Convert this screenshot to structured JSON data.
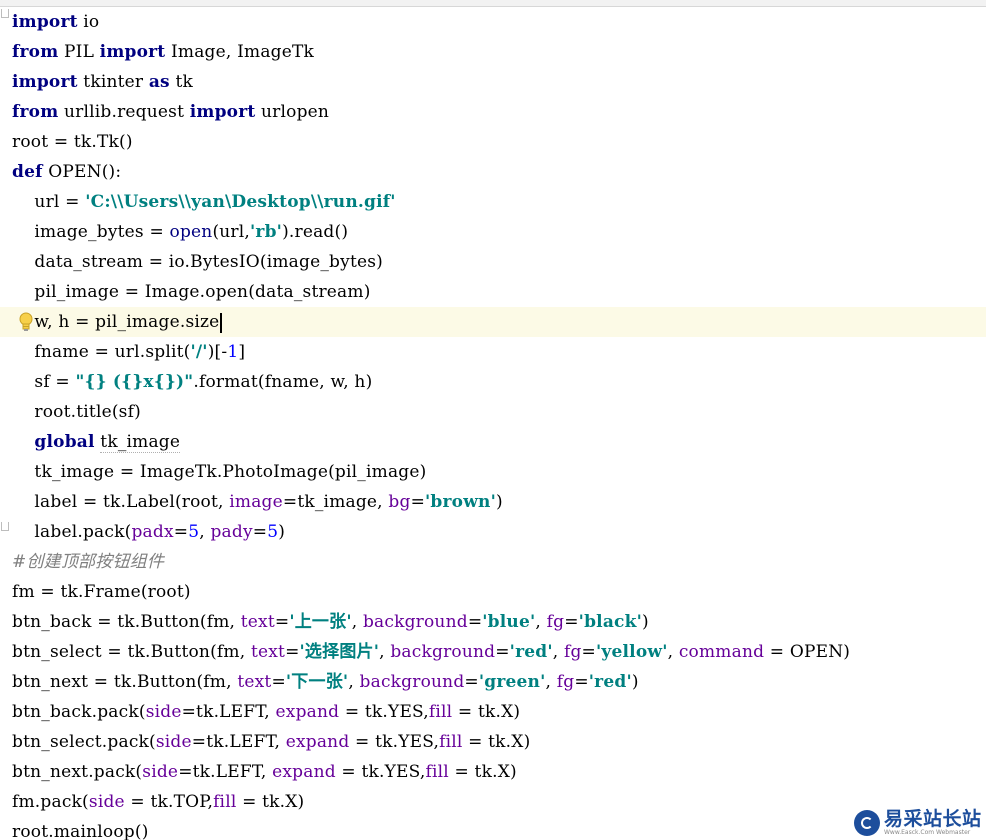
{
  "editor": {
    "lines": [
      [
        [
          "kw",
          "import"
        ],
        [
          "p",
          " io"
        ]
      ],
      [
        [
          "kw",
          "from"
        ],
        [
          "p",
          " PIL "
        ],
        [
          "kw",
          "import"
        ],
        [
          "p",
          " Image, ImageTk"
        ]
      ],
      [
        [
          "kw",
          "import"
        ],
        [
          "p",
          " tkinter "
        ],
        [
          "kw",
          "as"
        ],
        [
          "p",
          " tk"
        ]
      ],
      [
        [
          "kw",
          "from"
        ],
        [
          "p",
          " urllib.request "
        ],
        [
          "kw",
          "import"
        ],
        [
          "p",
          " urlopen"
        ]
      ],
      [
        [
          "p",
          "root = tk.Tk()"
        ]
      ],
      [
        [
          "kw",
          "def"
        ],
        [
          "p",
          " OPEN():"
        ]
      ],
      [
        [
          "p",
          "    url = "
        ],
        [
          "str",
          "'C:\\\\Users\\\\yan\\Desktop\\\\run.gif'"
        ]
      ],
      [
        [
          "p",
          "    image_bytes = "
        ],
        [
          "bi",
          "open"
        ],
        [
          "p",
          "(url,"
        ],
        [
          "str",
          "'rb'"
        ],
        [
          "p",
          ").read()"
        ]
      ],
      [
        [
          "p",
          "    data_stream = io.BytesIO(image_bytes)"
        ]
      ],
      [
        [
          "p",
          "    pil_image = Image.open(data_stream)"
        ]
      ],
      [
        [
          "p",
          "    w, h = pil_image.size"
        ]
      ],
      [
        [
          "p",
          "    fname = url.split("
        ],
        [
          "str",
          "'/'"
        ],
        [
          "p",
          ")[-"
        ],
        [
          "num",
          "1"
        ],
        [
          "p",
          "]"
        ]
      ],
      [
        [
          "p",
          "    sf = "
        ],
        [
          "str",
          "\"{} ({}x{})\""
        ],
        [
          "p",
          ".format(fname, w, h)"
        ]
      ],
      [
        [
          "p",
          "    root.title(sf)"
        ]
      ],
      [
        [
          "p",
          "    "
        ],
        [
          "kw",
          "global"
        ],
        [
          "p",
          " "
        ],
        [
          "weak",
          "tk_image"
        ]
      ],
      [
        [
          "p",
          "    tk_image = ImageTk.PhotoImage(pil_image)"
        ]
      ],
      [
        [
          "p",
          "    label = tk.Label(root, "
        ],
        [
          "kwarg",
          "image"
        ],
        [
          "p",
          "=tk_image, "
        ],
        [
          "kwarg",
          "bg"
        ],
        [
          "p",
          "="
        ],
        [
          "str",
          "'brown'"
        ],
        [
          "p",
          ")"
        ]
      ],
      [
        [
          "p",
          "    label.pack("
        ],
        [
          "kwarg",
          "padx"
        ],
        [
          "p",
          "="
        ],
        [
          "num",
          "5"
        ],
        [
          "p",
          ", "
        ],
        [
          "kwarg",
          "pady"
        ],
        [
          "p",
          "="
        ],
        [
          "num",
          "5"
        ],
        [
          "p",
          ")"
        ]
      ],
      [
        [
          "cmt",
          "#创建顶部按钮组件"
        ]
      ],
      [
        [
          "p",
          "fm = tk.Frame(root)"
        ]
      ],
      [
        [
          "p",
          "btn_back = tk.Button(fm, "
        ],
        [
          "kwarg",
          "text"
        ],
        [
          "p",
          "="
        ],
        [
          "str",
          "'上一张'"
        ],
        [
          "p",
          ", "
        ],
        [
          "kwarg",
          "background"
        ],
        [
          "p",
          "="
        ],
        [
          "str",
          "'blue'"
        ],
        [
          "p",
          ", "
        ],
        [
          "kwarg",
          "fg"
        ],
        [
          "p",
          "="
        ],
        [
          "str",
          "'black'"
        ],
        [
          "p",
          ")"
        ]
      ],
      [
        [
          "p",
          "btn_select = tk.Button(fm, "
        ],
        [
          "kwarg",
          "text"
        ],
        [
          "p",
          "="
        ],
        [
          "str",
          "'选择图片'"
        ],
        [
          "p",
          ", "
        ],
        [
          "kwarg",
          "background"
        ],
        [
          "p",
          "="
        ],
        [
          "str",
          "'red'"
        ],
        [
          "p",
          ", "
        ],
        [
          "kwarg",
          "fg"
        ],
        [
          "p",
          "="
        ],
        [
          "str",
          "'yellow'"
        ],
        [
          "p",
          ", "
        ],
        [
          "kwarg",
          "command"
        ],
        [
          "p",
          " = OPEN)"
        ]
      ],
      [
        [
          "p",
          "btn_next = tk.Button(fm, "
        ],
        [
          "kwarg",
          "text"
        ],
        [
          "p",
          "="
        ],
        [
          "str",
          "'下一张'"
        ],
        [
          "p",
          ", "
        ],
        [
          "kwarg",
          "background"
        ],
        [
          "p",
          "="
        ],
        [
          "str",
          "'green'"
        ],
        [
          "p",
          ", "
        ],
        [
          "kwarg",
          "fg"
        ],
        [
          "p",
          "="
        ],
        [
          "str",
          "'red'"
        ],
        [
          "p",
          ")"
        ]
      ],
      [
        [
          "p",
          "btn_back.pack("
        ],
        [
          "kwarg",
          "side"
        ],
        [
          "p",
          "=tk.LEFT, "
        ],
        [
          "kwarg",
          "expand"
        ],
        [
          "p",
          " = tk.YES,"
        ],
        [
          "kwarg",
          "fill"
        ],
        [
          "p",
          " = tk.X)"
        ]
      ],
      [
        [
          "p",
          "btn_select.pack("
        ],
        [
          "kwarg",
          "side"
        ],
        [
          "p",
          "=tk.LEFT, "
        ],
        [
          "kwarg",
          "expand"
        ],
        [
          "p",
          " = tk.YES,"
        ],
        [
          "kwarg",
          "fill"
        ],
        [
          "p",
          " = tk.X)"
        ]
      ],
      [
        [
          "p",
          "btn_next.pack("
        ],
        [
          "kwarg",
          "side"
        ],
        [
          "p",
          "=tk.LEFT, "
        ],
        [
          "kwarg",
          "expand"
        ],
        [
          "p",
          " = tk.YES,"
        ],
        [
          "kwarg",
          "fill"
        ],
        [
          "p",
          " = tk.X)"
        ]
      ],
      [
        [
          "p",
          "fm.pack("
        ],
        [
          "kwarg",
          "side"
        ],
        [
          "p",
          " = tk.TOP,"
        ],
        [
          "kwarg",
          "fill"
        ],
        [
          "p",
          " = tk.X)"
        ]
      ],
      [
        [
          "p",
          "root.mainloop()"
        ]
      ]
    ],
    "current_line": 10,
    "icons": {
      "hint": "lightbulb-icon",
      "fold": "fold-marker-icon"
    },
    "colors": {
      "keyword": "#000080",
      "string": "#008080",
      "number": "#0000ff",
      "kwarg": "#660099",
      "comment": "#808080",
      "current_line_bg": "#fcfae6"
    }
  },
  "watermark": {
    "text": "易采站长站",
    "subtext": "Www.Easck.Com Webmaster"
  }
}
